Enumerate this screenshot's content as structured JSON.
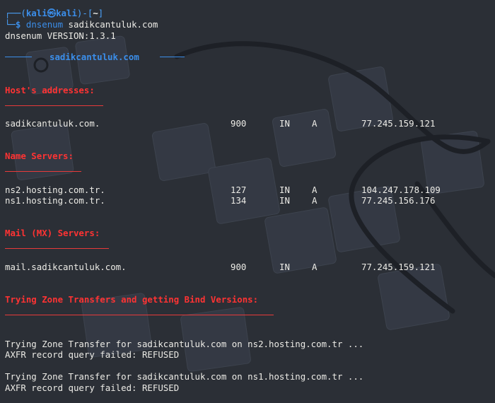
{
  "prompt": {
    "top_corner": "┌──(",
    "user": "kali",
    "at_symbol": "㉿",
    "host": "kali",
    "dir_open": ")-[",
    "dir": "~",
    "dir_close": "]",
    "bottom_corner": "└─",
    "dollar": "$",
    "command_name": "dnsenum",
    "command_arg": "sadikcantuluk.com"
  },
  "version_line": "dnsenum VERSION:1.3.1",
  "target_banner": "sadikcantuluk.com",
  "sections": {
    "hosts": {
      "title": "Host's addresses:",
      "rows": [
        {
          "name": "sadikcantuluk.com.",
          "ttl": "900",
          "cls": "IN",
          "type": "A",
          "addr": "77.245.159.121"
        }
      ]
    },
    "nameservers": {
      "title": "Name Servers:",
      "rows": [
        {
          "name": "ns2.hosting.com.tr.",
          "ttl": "127",
          "cls": "IN",
          "type": "A",
          "addr": "104.247.178.109"
        },
        {
          "name": "ns1.hosting.com.tr.",
          "ttl": "134",
          "cls": "IN",
          "type": "A",
          "addr": "77.245.156.176"
        }
      ]
    },
    "mx": {
      "title": "Mail (MX) Servers:",
      "rows": [
        {
          "name": "mail.sadikcantuluk.com.",
          "ttl": "900",
          "cls": "IN",
          "type": "A",
          "addr": "77.245.159.121"
        }
      ]
    },
    "zone": {
      "title": "Trying Zone Transfers and getting Bind Versions:",
      "attempts": [
        {
          "line": "Trying Zone Transfer for sadikcantuluk.com on ns2.hosting.com.tr ...",
          "result": "AXFR record query failed: REFUSED"
        },
        {
          "line": "Trying Zone Transfer for sadikcantuluk.com on ns1.hosting.com.tr ...",
          "result": "AXFR record query failed: REFUSED"
        }
      ]
    }
  },
  "colors": {
    "background": "#2b2f36",
    "prompt_blue": "#3b8eea",
    "section_red": "#ff3333",
    "text": "#ecebe6"
  }
}
